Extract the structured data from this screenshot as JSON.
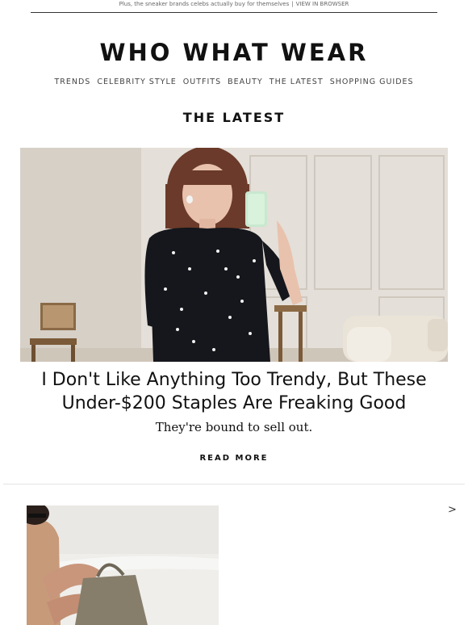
{
  "preheader": {
    "text": "Plus, the sneaker brands celebs actually buy for themselves",
    "separator": "|",
    "browser_link": "VIEW IN BROWSER"
  },
  "logo": {
    "text": "WHO WHAT WEAR"
  },
  "nav": {
    "items": [
      "TRENDS",
      "CELEBRITY STYLE",
      "OUTFITS",
      "BEAUTY",
      "THE LATEST",
      "SHOPPING GUIDES"
    ]
  },
  "section": {
    "title": "THE LATEST"
  },
  "article": {
    "headline_line1": "I Don't Like Anything Too Trendy, But These",
    "headline_line2": "Under-$200 Staples Are Freaking Good",
    "subhead": "They're bound to sell out.",
    "cta": "READ MORE"
  },
  "next": {
    "arrow": ">"
  },
  "colors": {
    "text": "#111111",
    "nav": "#444444",
    "divider": "#e3e3e3",
    "dress": "#15171c",
    "wall": "#ddd7cf"
  }
}
